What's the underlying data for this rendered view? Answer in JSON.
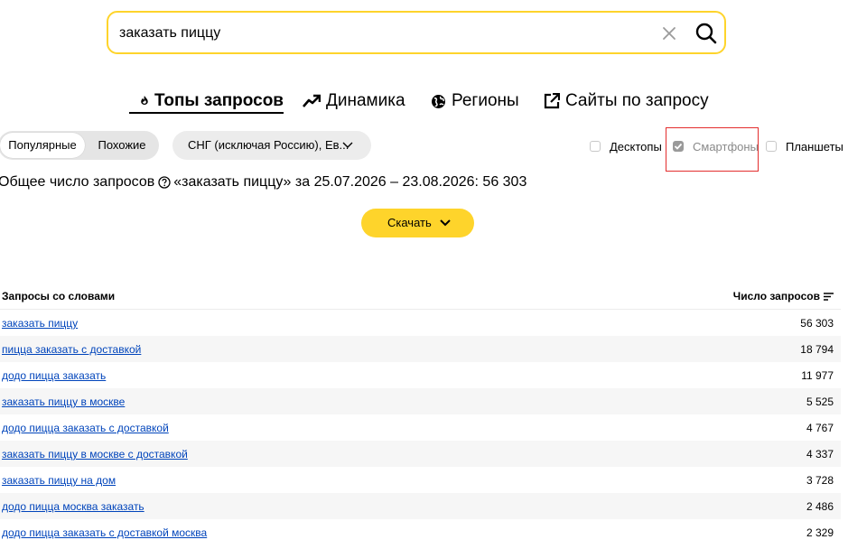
{
  "search": {
    "value": "заказать пиццу"
  },
  "tabs": [
    {
      "label": "Топы запросов",
      "icon": "flame-icon",
      "active": true
    },
    {
      "label": "Динамика",
      "icon": "trend-up-icon",
      "active": false
    },
    {
      "label": "Регионы",
      "icon": "globe-icon",
      "active": false
    },
    {
      "label": "Сайты по запросу",
      "icon": "external-link-icon",
      "active": false
    }
  ],
  "filters": {
    "mode": {
      "selected": "Популярные",
      "other": "Похожие"
    },
    "region": "СНГ (исключая Россию), Ев...",
    "devices": [
      {
        "label": "Десктопы",
        "checked": false
      },
      {
        "label": "Смартфоны",
        "checked": true,
        "disabled": true
      },
      {
        "label": "Планшеты",
        "checked": false
      }
    ]
  },
  "total": {
    "prefix": "Общее число запросов",
    "suffix": "«заказать пиццу» за 25.07.2026 – 23.08.2026: 56 303"
  },
  "download": {
    "label": "Скачать"
  },
  "table": {
    "col_query": "Запросы со словами",
    "col_count": "Число запросов",
    "rows": [
      {
        "query": "заказать пиццу",
        "count": "56 303"
      },
      {
        "query": "пицца заказать с доставкой",
        "count": "18 794"
      },
      {
        "query": "додо пицца заказать",
        "count": "11 977"
      },
      {
        "query": "заказать пиццу в москве",
        "count": "5 525"
      },
      {
        "query": "додо пицца заказать с доставкой",
        "count": "4 767"
      },
      {
        "query": "заказать пиццу в москве с доставкой",
        "count": "4 337"
      },
      {
        "query": "заказать пиццу на дом",
        "count": "3 728"
      },
      {
        "query": "додо пицца москва заказать",
        "count": "2 486"
      },
      {
        "query": "додо пицца заказать с доставкой москва",
        "count": "2 329"
      }
    ]
  },
  "colors": {
    "accent": "#fed42b",
    "link": "#0044bb",
    "highlight": "#e32d2d"
  }
}
